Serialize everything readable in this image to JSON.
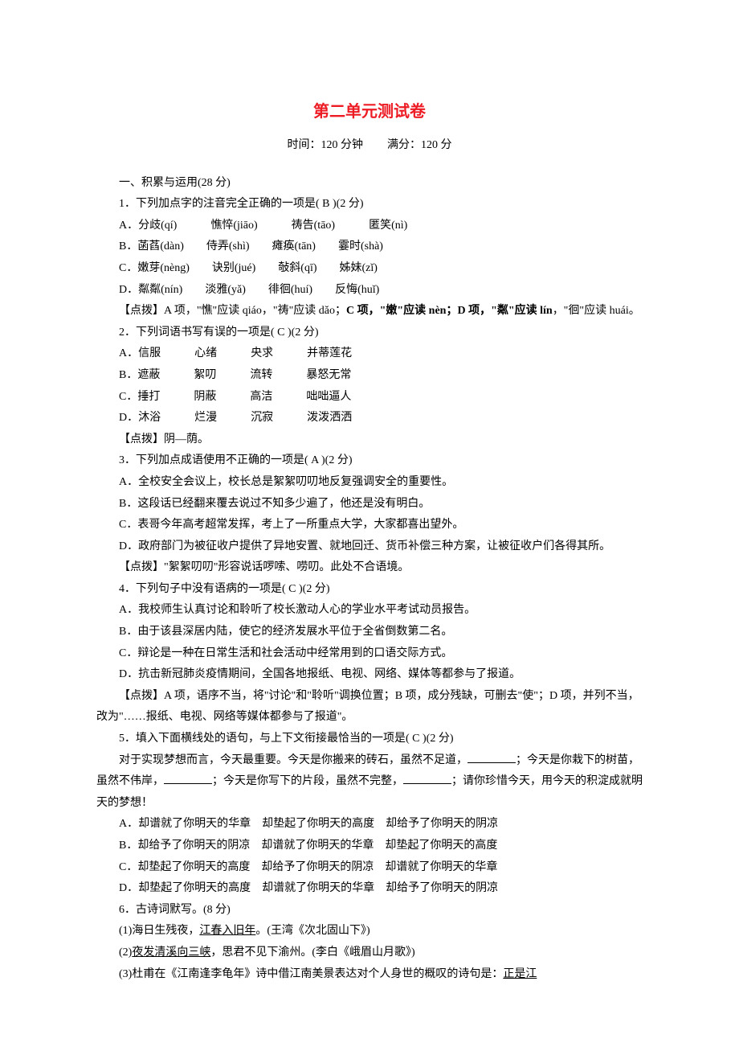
{
  "title": "第二单元测试卷",
  "time_label": "时间：120 分钟",
  "score_label": "满分：120 分",
  "section1_heading": "一、积累与运用(28 分)",
  "q1": {
    "stem": "1．下列加点字的注音完全正确的一项是(  B  )(2 分)",
    "A": "A．分歧(qí)　　　憔悴(jiāo)　　　祷告(tāo)　　　匿笑(nì)",
    "B": "B．菡萏(dàn)　　侍弄(shì)　　瘫痪(tān)　　霎时(shà)",
    "C": "C．嫩芽(nèng)　　诀别(jué)　　敧斜(qī)　　姊妹(zǐ)",
    "D": "D．粼粼(nín)　　淡雅(yǎ)　　徘徊(huí)　　反悔(huǐ)",
    "hint_prefix": "【点拨】A 项，\"憔\"应读 qiáo，\"祷\"应读 dǎo；",
    "hint_bold": "C 项，\"嫩\"应读 nèn；D 项，\"粼\"应读 lín",
    "hint_suffix": "，\"徊\"应读 huái。"
  },
  "q2": {
    "stem": "2．下列词语书写有误的一项是(  C  )(2 分)",
    "A": "A．信服　　　心绪　　　央求　　　并蒂莲花",
    "B": "B．遮蔽　　　絮叨　　　流转　　　暴怒无常",
    "C": "C．捶打　　　阴蔽　　　高洁　　　咄咄逼人",
    "D": "D．沐浴　　　烂漫　　　沉寂　　　泼泼洒洒",
    "hint": "【点拨】阴—荫。"
  },
  "q3": {
    "stem": "3．下列加点成语使用不正确的一项是(  A  )(2 分)",
    "A": "A．全校安全会议上，校长总是絮絮叨叨地反复强调安全的重要性。",
    "B": "B．这段话已经翻来覆去说过不知多少遍了，他还是没有明白。",
    "C": "C．表哥今年高考超常发挥，考上了一所重点大学，大家都喜出望外。",
    "D": "D．政府部门为被征收户提供了异地安置、就地回迁、货币补偿三种方案，让被征收户们各得其所。",
    "hint": "【点拨】\"絮絮叨叨\"形容说话啰嗦、唠叨。此处不合语境。"
  },
  "q4": {
    "stem": "4．下列句子中没有语病的一项是(  C  )(2 分)",
    "A": "A．我校师生认真讨论和聆听了校长激动人心的学业水平考试动员报告。",
    "B": "B．由于该县深居内陆，使它的经济发展水平位于全省倒数第二名。",
    "C": "C．辩论是一种在日常生活和社会活动中经常用到的口语交际方式。",
    "D": "D．抗击新冠肺炎疫情期间，全国各地报纸、电视、网络、媒体等都参与了报道。",
    "hint": "【点拨】A 项，语序不当，将\"讨论\"和\"聆听\"调换位置；B 项，成分残缺，可删去\"使\"；D 项，并列不当，改为\"……报纸、电视、网络等媒体都参与了报道\"。"
  },
  "q5": {
    "stem": "5．填入下面横线处的语句，与上下文衔接最恰当的一项是(  C  )(2 分)",
    "passage_p1": "对于实现梦想而言，今天最重要。今天是你搬来的砖石，虽然不足道，",
    "passage_p2": "；今天是你栽下的树苗，虽然不伟岸，",
    "passage_p3": "；今天是你写下的片段，虽然不完整，",
    "passage_p4": "；请你珍惜今天，用今天的积淀成就明天的梦想！",
    "A": "A．却谱就了你明天的华章　却垫起了你明天的高度　却给予了你明天的阴凉",
    "B": "B．却给予了你明天的阴凉　却谱就了你明天的华章　却垫起了你明天的高度",
    "C": "C．却垫起了你明天的高度　却给予了你明天的阴凉　却谱就了你明天的华章",
    "D": "D．却垫起了你明天的高度　却谱就了你明天的华章　却给予了你明天的阴凉"
  },
  "q6": {
    "stem": "6．古诗词默写。(8 分)",
    "l1a": "(1)海日生残夜，",
    "l1b": "江春入旧年",
    "l1c": "。(王湾《次北固山下》)",
    "l2a": "(2)",
    "l2b": "夜发清溪向三峡",
    "l2c": "，思君不见下渝州。(李白《峨眉山月歌》)",
    "l3a": "(3)杜甫在《江南逢李龟年》诗中借江南美景表达对个人身世的概叹的诗句是：",
    "l3b": "正是江"
  }
}
